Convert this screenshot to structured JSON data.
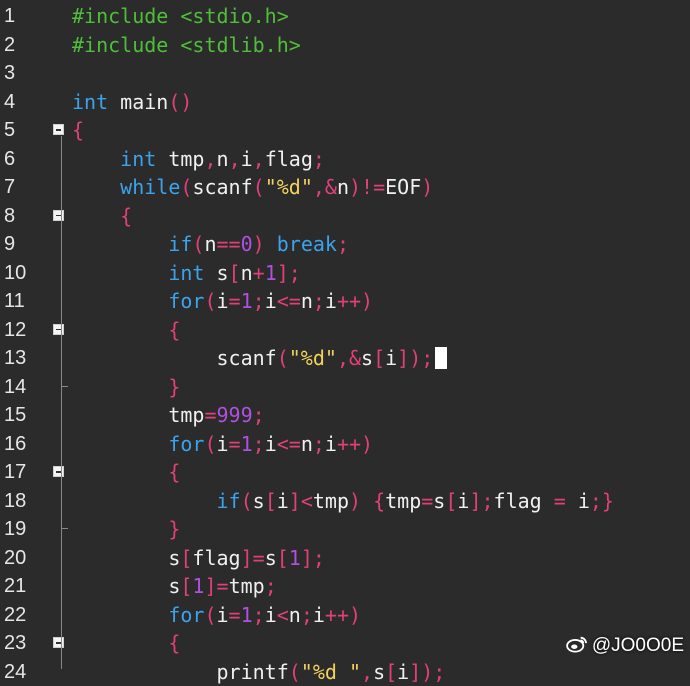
{
  "colors": {
    "background": "#2b2b2b",
    "default": "#f0f0f0",
    "keyword": "#3ba3ec",
    "preprocessor": "#4fbf3a",
    "paren": "#e0407a",
    "operator": "#e0407a",
    "number": "#b04fe0",
    "string": "#f3d35d",
    "brace": "#e0407a"
  },
  "editor": {
    "lines": [
      {
        "num": "1",
        "fold": "none",
        "tokens": [
          {
            "t": "#include <stdio.h>",
            "k": "preprocessor"
          }
        ]
      },
      {
        "num": "2",
        "fold": "none",
        "tokens": [
          {
            "t": "#include <stdlib.h>",
            "k": "preprocessor"
          }
        ]
      },
      {
        "num": "3",
        "fold": "none",
        "tokens": []
      },
      {
        "num": "4",
        "fold": "none",
        "tokens": [
          {
            "t": "int",
            "k": "keyword"
          },
          {
            "t": " main",
            "k": "default"
          },
          {
            "t": "()",
            "k": "paren"
          }
        ]
      },
      {
        "num": "5",
        "fold": "open",
        "tokens": [
          {
            "t": "{",
            "k": "brace"
          }
        ]
      },
      {
        "num": "6",
        "fold": "none",
        "tokens": [
          {
            "t": "    ",
            "k": "default"
          },
          {
            "t": "int",
            "k": "keyword"
          },
          {
            "t": " tmp",
            "k": "default"
          },
          {
            "t": ",",
            "k": "operator"
          },
          {
            "t": "n",
            "k": "default"
          },
          {
            "t": ",",
            "k": "operator"
          },
          {
            "t": "i",
            "k": "default"
          },
          {
            "t": ",",
            "k": "operator"
          },
          {
            "t": "flag",
            "k": "default"
          },
          {
            "t": ";",
            "k": "operator"
          }
        ]
      },
      {
        "num": "7",
        "fold": "none",
        "tokens": [
          {
            "t": "    ",
            "k": "default"
          },
          {
            "t": "while",
            "k": "keyword"
          },
          {
            "t": "(",
            "k": "paren"
          },
          {
            "t": "scanf",
            "k": "default"
          },
          {
            "t": "(",
            "k": "paren"
          },
          {
            "t": "\"%d\"",
            "k": "string"
          },
          {
            "t": ",&",
            "k": "operator"
          },
          {
            "t": "n",
            "k": "default"
          },
          {
            "t": ")!=",
            "k": "paren"
          },
          {
            "t": "EOF",
            "k": "default"
          },
          {
            "t": ")",
            "k": "paren"
          }
        ]
      },
      {
        "num": "8",
        "fold": "open",
        "tokens": [
          {
            "t": "    ",
            "k": "default"
          },
          {
            "t": "{",
            "k": "brace"
          }
        ]
      },
      {
        "num": "9",
        "fold": "none",
        "tokens": [
          {
            "t": "        ",
            "k": "default"
          },
          {
            "t": "if",
            "k": "keyword"
          },
          {
            "t": "(",
            "k": "paren"
          },
          {
            "t": "n",
            "k": "default"
          },
          {
            "t": "==",
            "k": "operator"
          },
          {
            "t": "0",
            "k": "number"
          },
          {
            "t": ") ",
            "k": "paren"
          },
          {
            "t": "break",
            "k": "keyword"
          },
          {
            "t": ";",
            "k": "operator"
          }
        ]
      },
      {
        "num": "10",
        "fold": "none",
        "tokens": [
          {
            "t": "        ",
            "k": "default"
          },
          {
            "t": "int",
            "k": "keyword"
          },
          {
            "t": " s",
            "k": "default"
          },
          {
            "t": "[",
            "k": "paren"
          },
          {
            "t": "n",
            "k": "default"
          },
          {
            "t": "+",
            "k": "operator"
          },
          {
            "t": "1",
            "k": "number"
          },
          {
            "t": "];",
            "k": "paren"
          }
        ]
      },
      {
        "num": "11",
        "fold": "none",
        "tokens": [
          {
            "t": "        ",
            "k": "default"
          },
          {
            "t": "for",
            "k": "keyword"
          },
          {
            "t": "(",
            "k": "paren"
          },
          {
            "t": "i",
            "k": "default"
          },
          {
            "t": "=",
            "k": "operator"
          },
          {
            "t": "1",
            "k": "number"
          },
          {
            "t": ";",
            "k": "operator"
          },
          {
            "t": "i",
            "k": "default"
          },
          {
            "t": "<=",
            "k": "operator"
          },
          {
            "t": "n",
            "k": "default"
          },
          {
            "t": ";",
            "k": "operator"
          },
          {
            "t": "i",
            "k": "default"
          },
          {
            "t": "++)",
            "k": "operator"
          }
        ]
      },
      {
        "num": "12",
        "fold": "open",
        "tokens": [
          {
            "t": "        ",
            "k": "default"
          },
          {
            "t": "{",
            "k": "brace"
          }
        ]
      },
      {
        "num": "13",
        "fold": "none",
        "tokens": [
          {
            "t": "            ",
            "k": "default"
          },
          {
            "t": "scanf",
            "k": "default"
          },
          {
            "t": "(",
            "k": "paren"
          },
          {
            "t": "\"%d\"",
            "k": "string"
          },
          {
            "t": ",&",
            "k": "operator"
          },
          {
            "t": "s",
            "k": "default"
          },
          {
            "t": "[",
            "k": "paren"
          },
          {
            "t": "i",
            "k": "default"
          },
          {
            "t": "]);",
            "k": "paren"
          }
        ],
        "cursor": true
      },
      {
        "num": "14",
        "fold": "end",
        "tokens": [
          {
            "t": "        ",
            "k": "default"
          },
          {
            "t": "}",
            "k": "brace"
          }
        ]
      },
      {
        "num": "15",
        "fold": "none",
        "tokens": [
          {
            "t": "        ",
            "k": "default"
          },
          {
            "t": "tmp",
            "k": "default"
          },
          {
            "t": "=",
            "k": "operator"
          },
          {
            "t": "999",
            "k": "number"
          },
          {
            "t": ";",
            "k": "operator"
          }
        ]
      },
      {
        "num": "16",
        "fold": "none",
        "tokens": [
          {
            "t": "        ",
            "k": "default"
          },
          {
            "t": "for",
            "k": "keyword"
          },
          {
            "t": "(",
            "k": "paren"
          },
          {
            "t": "i",
            "k": "default"
          },
          {
            "t": "=",
            "k": "operator"
          },
          {
            "t": "1",
            "k": "number"
          },
          {
            "t": ";",
            "k": "operator"
          },
          {
            "t": "i",
            "k": "default"
          },
          {
            "t": "<=",
            "k": "operator"
          },
          {
            "t": "n",
            "k": "default"
          },
          {
            "t": ";",
            "k": "operator"
          },
          {
            "t": "i",
            "k": "default"
          },
          {
            "t": "++)",
            "k": "operator"
          }
        ]
      },
      {
        "num": "17",
        "fold": "open",
        "tokens": [
          {
            "t": "        ",
            "k": "default"
          },
          {
            "t": "{",
            "k": "brace"
          }
        ]
      },
      {
        "num": "18",
        "fold": "none",
        "tokens": [
          {
            "t": "            ",
            "k": "default"
          },
          {
            "t": "if",
            "k": "keyword"
          },
          {
            "t": "(",
            "k": "paren"
          },
          {
            "t": "s",
            "k": "default"
          },
          {
            "t": "[",
            "k": "paren"
          },
          {
            "t": "i",
            "k": "default"
          },
          {
            "t": "]<",
            "k": "paren"
          },
          {
            "t": "tmp",
            "k": "default"
          },
          {
            "t": ") {",
            "k": "paren"
          },
          {
            "t": "tmp",
            "k": "default"
          },
          {
            "t": "=",
            "k": "operator"
          },
          {
            "t": "s",
            "k": "default"
          },
          {
            "t": "[",
            "k": "paren"
          },
          {
            "t": "i",
            "k": "default"
          },
          {
            "t": "];",
            "k": "paren"
          },
          {
            "t": "flag",
            "k": "default"
          },
          {
            "t": " = ",
            "k": "operator"
          },
          {
            "t": "i",
            "k": "default"
          },
          {
            "t": ";}",
            "k": "brace"
          }
        ]
      },
      {
        "num": "19",
        "fold": "end",
        "tokens": [
          {
            "t": "        ",
            "k": "default"
          },
          {
            "t": "}",
            "k": "brace"
          }
        ]
      },
      {
        "num": "20",
        "fold": "none",
        "tokens": [
          {
            "t": "        ",
            "k": "default"
          },
          {
            "t": "s",
            "k": "default"
          },
          {
            "t": "[",
            "k": "paren"
          },
          {
            "t": "flag",
            "k": "default"
          },
          {
            "t": "]=",
            "k": "paren"
          },
          {
            "t": "s",
            "k": "default"
          },
          {
            "t": "[",
            "k": "paren"
          },
          {
            "t": "1",
            "k": "number"
          },
          {
            "t": "];",
            "k": "paren"
          }
        ]
      },
      {
        "num": "21",
        "fold": "none",
        "tokens": [
          {
            "t": "        ",
            "k": "default"
          },
          {
            "t": "s",
            "k": "default"
          },
          {
            "t": "[",
            "k": "paren"
          },
          {
            "t": "1",
            "k": "number"
          },
          {
            "t": "]=",
            "k": "paren"
          },
          {
            "t": "tmp",
            "k": "default"
          },
          {
            "t": ";",
            "k": "operator"
          }
        ]
      },
      {
        "num": "22",
        "fold": "none",
        "tokens": [
          {
            "t": "        ",
            "k": "default"
          },
          {
            "t": "for",
            "k": "keyword"
          },
          {
            "t": "(",
            "k": "paren"
          },
          {
            "t": "i",
            "k": "default"
          },
          {
            "t": "=",
            "k": "operator"
          },
          {
            "t": "1",
            "k": "number"
          },
          {
            "t": ";",
            "k": "operator"
          },
          {
            "t": "i",
            "k": "default"
          },
          {
            "t": "<",
            "k": "operator"
          },
          {
            "t": "n",
            "k": "default"
          },
          {
            "t": ";",
            "k": "operator"
          },
          {
            "t": "i",
            "k": "default"
          },
          {
            "t": "++)",
            "k": "operator"
          }
        ]
      },
      {
        "num": "23",
        "fold": "open",
        "tokens": [
          {
            "t": "        ",
            "k": "default"
          },
          {
            "t": "{",
            "k": "brace"
          }
        ]
      },
      {
        "num": "24",
        "fold": "none",
        "tokens": [
          {
            "t": "            ",
            "k": "default"
          },
          {
            "t": "printf",
            "k": "default"
          },
          {
            "t": "(",
            "k": "paren"
          },
          {
            "t": "\"%d \"",
            "k": "string"
          },
          {
            "t": ",",
            "k": "operator"
          },
          {
            "t": "s",
            "k": "default"
          },
          {
            "t": "[",
            "k": "paren"
          },
          {
            "t": "i",
            "k": "default"
          },
          {
            "t": "]);",
            "k": "paren"
          }
        ]
      }
    ]
  },
  "watermark": {
    "icon": "weibo-icon",
    "text": "@JO0O0E"
  }
}
